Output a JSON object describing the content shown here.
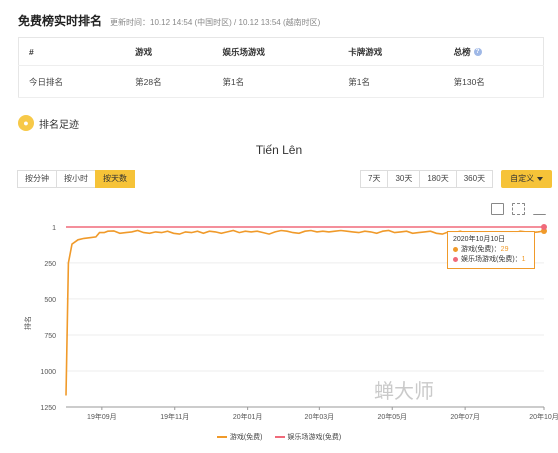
{
  "header": {
    "title": "免费榜实时排名",
    "update_time": "更新时间：10.12 14:54 (中国时区) / 10.12 13:54 (越南时区)"
  },
  "rank_table": {
    "headers": [
      "#",
      "游戏",
      "娱乐场游戏",
      "卡牌游戏",
      "总榜"
    ],
    "row_label": "今日排名",
    "values": [
      "第28名",
      "第1名",
      "第1名",
      "第130名"
    ]
  },
  "section": {
    "title": "排名足迹"
  },
  "chart_title": "Tiến Lên",
  "granularity_buttons": [
    "按分钟",
    "按小时",
    "按天数"
  ],
  "granularity_active": "按天数",
  "range_buttons": [
    "7天",
    "30天",
    "180天",
    "360天"
  ],
  "custom_label": "自定义",
  "tooltip": {
    "date": "2020年10月10日",
    "rows": [
      {
        "label": "游戏(免费)：",
        "value": "29",
        "color": "#f09a2a"
      },
      {
        "label": "娱乐场游戏(免费)：",
        "value": "1",
        "color": "#f06a7a"
      }
    ]
  },
  "watermark": "蝉大师",
  "colors": {
    "accent": "#f6c338",
    "game": "#f09a2a",
    "casino": "#f06a7a"
  },
  "chart_data": {
    "type": "line",
    "ylabel": "排名",
    "y_reversed": true,
    "ylim": [
      1,
      1250
    ],
    "yticks": [
      1,
      250,
      500,
      750,
      1000,
      1250
    ],
    "xticks": [
      "19年09月",
      "19年11月",
      "20年01月",
      "20年03月",
      "20年05月",
      "20年07月",
      "20年10月"
    ],
    "xlim_days": [
      0,
      400
    ],
    "xtick_days": [
      30,
      91,
      152,
      212,
      273,
      334,
      400
    ],
    "series": [
      {
        "name": "游戏(免费)",
        "color": "#f09a2a",
        "points": [
          [
            0,
            1170
          ],
          [
            2,
            250
          ],
          [
            5,
            120
          ],
          [
            10,
            90
          ],
          [
            15,
            80
          ],
          [
            20,
            75
          ],
          [
            25,
            70
          ],
          [
            28,
            40
          ],
          [
            32,
            40
          ],
          [
            35,
            30
          ],
          [
            40,
            28
          ],
          [
            45,
            45
          ],
          [
            50,
            40
          ],
          [
            55,
            35
          ],
          [
            60,
            25
          ],
          [
            65,
            40
          ],
          [
            70,
            45
          ],
          [
            75,
            35
          ],
          [
            80,
            40
          ],
          [
            85,
            30
          ],
          [
            90,
            45
          ],
          [
            95,
            50
          ],
          [
            100,
            35
          ],
          [
            105,
            40
          ],
          [
            110,
            30
          ],
          [
            115,
            45
          ],
          [
            120,
            30
          ],
          [
            125,
            35
          ],
          [
            130,
            45
          ],
          [
            135,
            35
          ],
          [
            140,
            25
          ],
          [
            145,
            40
          ],
          [
            150,
            30
          ],
          [
            155,
            35
          ],
          [
            160,
            30
          ],
          [
            165,
            40
          ],
          [
            170,
            50
          ],
          [
            175,
            35
          ],
          [
            180,
            25
          ],
          [
            185,
            30
          ],
          [
            190,
            40
          ],
          [
            195,
            45
          ],
          [
            200,
            30
          ],
          [
            205,
            25
          ],
          [
            210,
            35
          ],
          [
            215,
            30
          ],
          [
            220,
            35
          ],
          [
            225,
            30
          ],
          [
            230,
            25
          ],
          [
            235,
            30
          ],
          [
            240,
            35
          ],
          [
            245,
            40
          ],
          [
            250,
            30
          ],
          [
            255,
            35
          ],
          [
            260,
            45
          ],
          [
            265,
            30
          ],
          [
            270,
            25
          ],
          [
            275,
            40
          ],
          [
            280,
            35
          ],
          [
            285,
            30
          ],
          [
            290,
            45
          ],
          [
            295,
            40
          ],
          [
            300,
            35
          ],
          [
            305,
            30
          ],
          [
            310,
            45
          ],
          [
            315,
            50
          ],
          [
            320,
            35
          ],
          [
            325,
            40
          ],
          [
            330,
            30
          ],
          [
            335,
            45
          ],
          [
            340,
            50
          ],
          [
            345,
            35
          ],
          [
            350,
            40
          ],
          [
            355,
            50
          ],
          [
            360,
            60
          ],
          [
            365,
            40
          ],
          [
            370,
            35
          ],
          [
            375,
            45
          ],
          [
            380,
            30
          ],
          [
            385,
            35
          ],
          [
            390,
            40
          ],
          [
            395,
            35
          ],
          [
            400,
            29
          ]
        ]
      },
      {
        "name": "娱乐场游戏(免费)",
        "color": "#f06a7a",
        "points": [
          [
            0,
            1
          ],
          [
            400,
            1
          ]
        ]
      }
    ]
  }
}
